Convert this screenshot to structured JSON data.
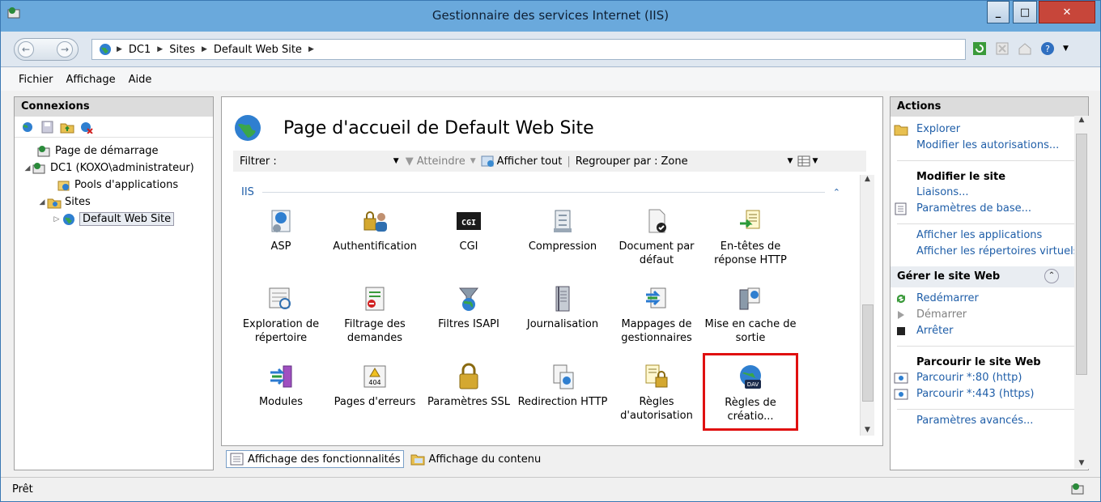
{
  "window": {
    "title": "Gestionnaire des services Internet (IIS)"
  },
  "address": {
    "segments": [
      "DC1",
      "Sites",
      "Default Web Site"
    ]
  },
  "menu": [
    "Fichier",
    "Affichage",
    "Aide"
  ],
  "connections": {
    "header": "Connexions",
    "tree": [
      {
        "label": "Page de démarrage",
        "level": 0
      },
      {
        "label": "DC1 (KOXO\\administrateur)",
        "level": 0
      },
      {
        "label": "Pools d'applications",
        "level": 1
      },
      {
        "label": "Sites",
        "level": 1
      },
      {
        "label": "Default Web Site",
        "level": 2
      }
    ]
  },
  "main": {
    "title": "Page d'accueil de Default Web Site",
    "filter": {
      "label": "Filtrer :",
      "goto": "Atteindre",
      "show_all": "Afficher tout",
      "group_label": "Regrouper par :",
      "group_value": "Zone"
    },
    "group": "IIS",
    "features": [
      "ASP",
      "Authentification",
      "CGI",
      "Compression",
      "Document par défaut",
      "En-têtes de réponse HTTP",
      "Exploration de répertoire",
      "Filtrage des demandes",
      "Filtres ISAPI",
      "Journalisation",
      "Mappages de gestionnaires",
      "Mise en cache de sortie",
      "Modules",
      "Pages d'erreurs",
      "Paramètres SSL",
      "Redirection HTTP",
      "Règles d'autorisation",
      "Règles de créatio..."
    ],
    "tabs": [
      "Affichage des fonctionnalités",
      "Affichage du contenu"
    ]
  },
  "actions": {
    "header": "Actions",
    "explore": "Explorer",
    "edit_permissions": "Modifier les autorisations...",
    "edit_site_header": "Modifier le site",
    "bindings": "Liaisons...",
    "basic_settings": "Paramètres de base...",
    "view_apps": "Afficher les applications",
    "view_vdirs": "Afficher les répertoires virtuels",
    "manage_header": "Gérer le site Web",
    "restart": "Redémarrer",
    "start": "Démarrer",
    "stop": "Arrêter",
    "browse_header": "Parcourir le site Web",
    "browse_http": "Parcourir *:80 (http)",
    "browse_https": "Parcourir *:443 (https)",
    "advanced": "Paramètres avancés..."
  },
  "status": {
    "text": "Prêt"
  },
  "colors": {
    "link": "#1f5ea8",
    "titlebar": "#6aa9dc",
    "highlight": "#e01010"
  }
}
